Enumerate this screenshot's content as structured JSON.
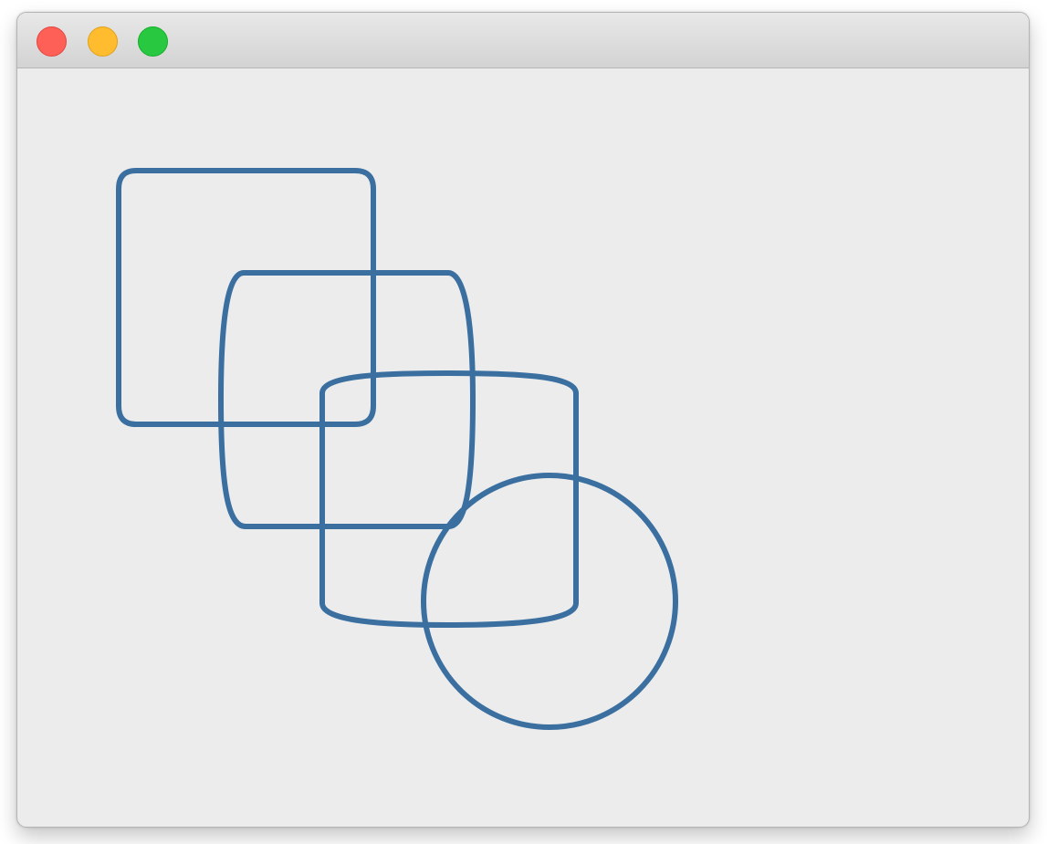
{
  "window": {
    "title": "",
    "controls": {
      "close": "close-icon",
      "minimize": "minimize-icon",
      "zoom": "zoom-icon"
    }
  },
  "canvas": {
    "background": "#ececed",
    "stroke_color": "#3a6fa0",
    "shapes": [
      {
        "kind": "rounded-rectangle",
        "corner_roundness": "small"
      },
      {
        "kind": "superellipse",
        "corner_roundness": "medium"
      },
      {
        "kind": "squircle",
        "corner_roundness": "large"
      },
      {
        "kind": "circle",
        "corner_roundness": "full"
      }
    ]
  }
}
